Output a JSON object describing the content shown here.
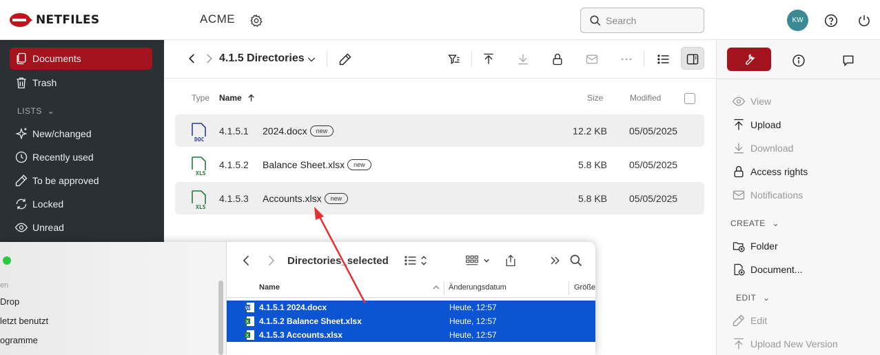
{
  "header": {
    "brand": "NETFILES",
    "company": "ACME",
    "search_placeholder": "Search",
    "avatar_initials": "KW"
  },
  "sidebar": {
    "items": [
      {
        "label": "Documents",
        "icon": "documents-icon",
        "active": true
      },
      {
        "label": "Trash",
        "icon": "trash-icon"
      }
    ],
    "lists_label": "LISTS",
    "lists": [
      {
        "label": "New/changed",
        "icon": "sparkle-icon"
      },
      {
        "label": "Recently used",
        "icon": "clock-icon"
      },
      {
        "label": "To be approved",
        "icon": "pencil-icon"
      },
      {
        "label": "Locked",
        "icon": "refresh-icon"
      },
      {
        "label": "Unread",
        "icon": "eye-icon"
      }
    ]
  },
  "toolbar": {
    "folder_title": "4.1.5 Directories"
  },
  "table": {
    "headers": {
      "type": "Type",
      "name": "Name",
      "size": "Size",
      "modified": "Modified"
    },
    "rows": [
      {
        "num": "4.1.5.1",
        "name": "2024.docx",
        "badge": "new",
        "size": "12.2 KB",
        "modified": "05/05/2025",
        "kind": "DOC"
      },
      {
        "num": "4.1.5.2",
        "name": "Balance Sheet.xlsx",
        "badge": "new",
        "size": "5.8 KB",
        "modified": "05/05/2025",
        "kind": "XLS"
      },
      {
        "num": "4.1.5.3",
        "name": "Accounts.xlsx",
        "badge": "new",
        "size": "5.8 KB",
        "modified": "05/05/2025",
        "kind": "XLS"
      }
    ]
  },
  "panel": {
    "actions": [
      {
        "label": "View",
        "disabled": true
      },
      {
        "label": "Upload",
        "disabled": false
      },
      {
        "label": "Download",
        "disabled": true
      },
      {
        "label": "Access rights",
        "disabled": false
      },
      {
        "label": "Notifications",
        "disabled": true
      }
    ],
    "create_label": "CREATE",
    "create": [
      {
        "label": "Folder"
      },
      {
        "label": "Document..."
      }
    ],
    "edit_label": "EDIT",
    "edit": [
      {
        "label": "Edit",
        "disabled": true
      },
      {
        "label": "Upload New Version",
        "disabled": true
      }
    ]
  },
  "finder": {
    "title": "Directories_selected",
    "sidebar": {
      "section": "en",
      "items": [
        "Drop",
        "letzt benutzt",
        "ogramme"
      ]
    },
    "headers": {
      "name": "Name",
      "date": "Änderungsdatum",
      "size": "Größe"
    },
    "rows": [
      {
        "name": "4.1.5.1 2024.docx",
        "date": "Heute, 12:57"
      },
      {
        "name": "4.1.5.2 Balance Sheet.xlsx",
        "date": "Heute, 12:57"
      },
      {
        "name": "4.1.5.3 Accounts.xlsx",
        "date": "Heute, 12:57"
      }
    ]
  },
  "colors": {
    "accent": "#a3131d",
    "sidebar_bg": "#2a3033",
    "finder_selection": "#0b55d2",
    "annotation_arrow": "#e53030"
  }
}
